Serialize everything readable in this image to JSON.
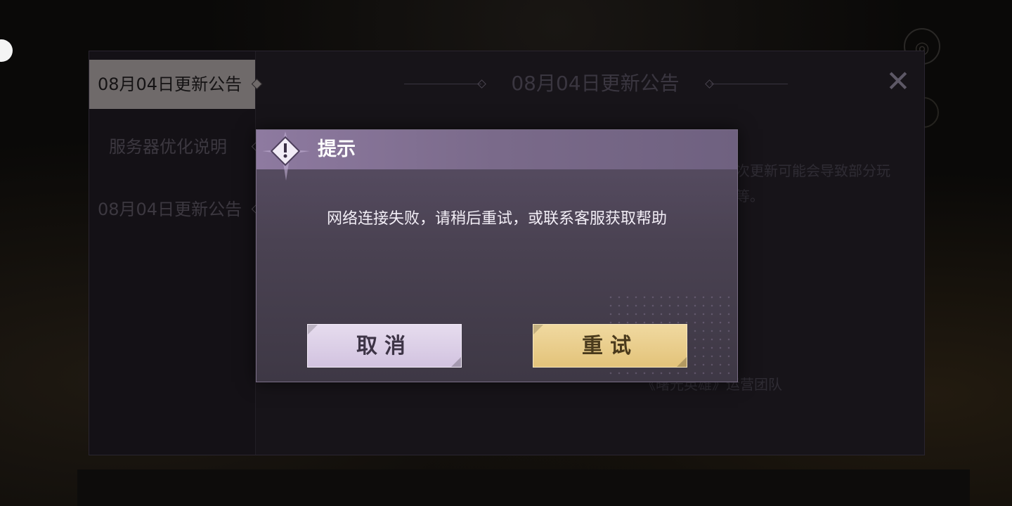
{
  "announcement_panel": {
    "sidebar": {
      "items": [
        {
          "label": "08月04日更新公告",
          "active": true
        },
        {
          "label": "服务器优化说明",
          "active": false
        },
        {
          "label": "08月04日更新公告",
          "active": false
        }
      ]
    },
    "title": "08月04日更新公告",
    "close_icon": "close-icon",
    "body_lines": [
      "次更新可能会导致部分玩",
      "等。"
    ],
    "signature": "《曙光英雄》运营团队"
  },
  "dialog": {
    "title": "提示",
    "icon": "warning-icon",
    "message": "网络连接失败，请稍后重试，或联系客服获取帮助",
    "cancel_label": "取消",
    "retry_label": "重试"
  },
  "colors": {
    "dialog_header": "#8e7aa0",
    "cancel_button": "#e6dcee",
    "retry_button": "#f0d9a0"
  }
}
